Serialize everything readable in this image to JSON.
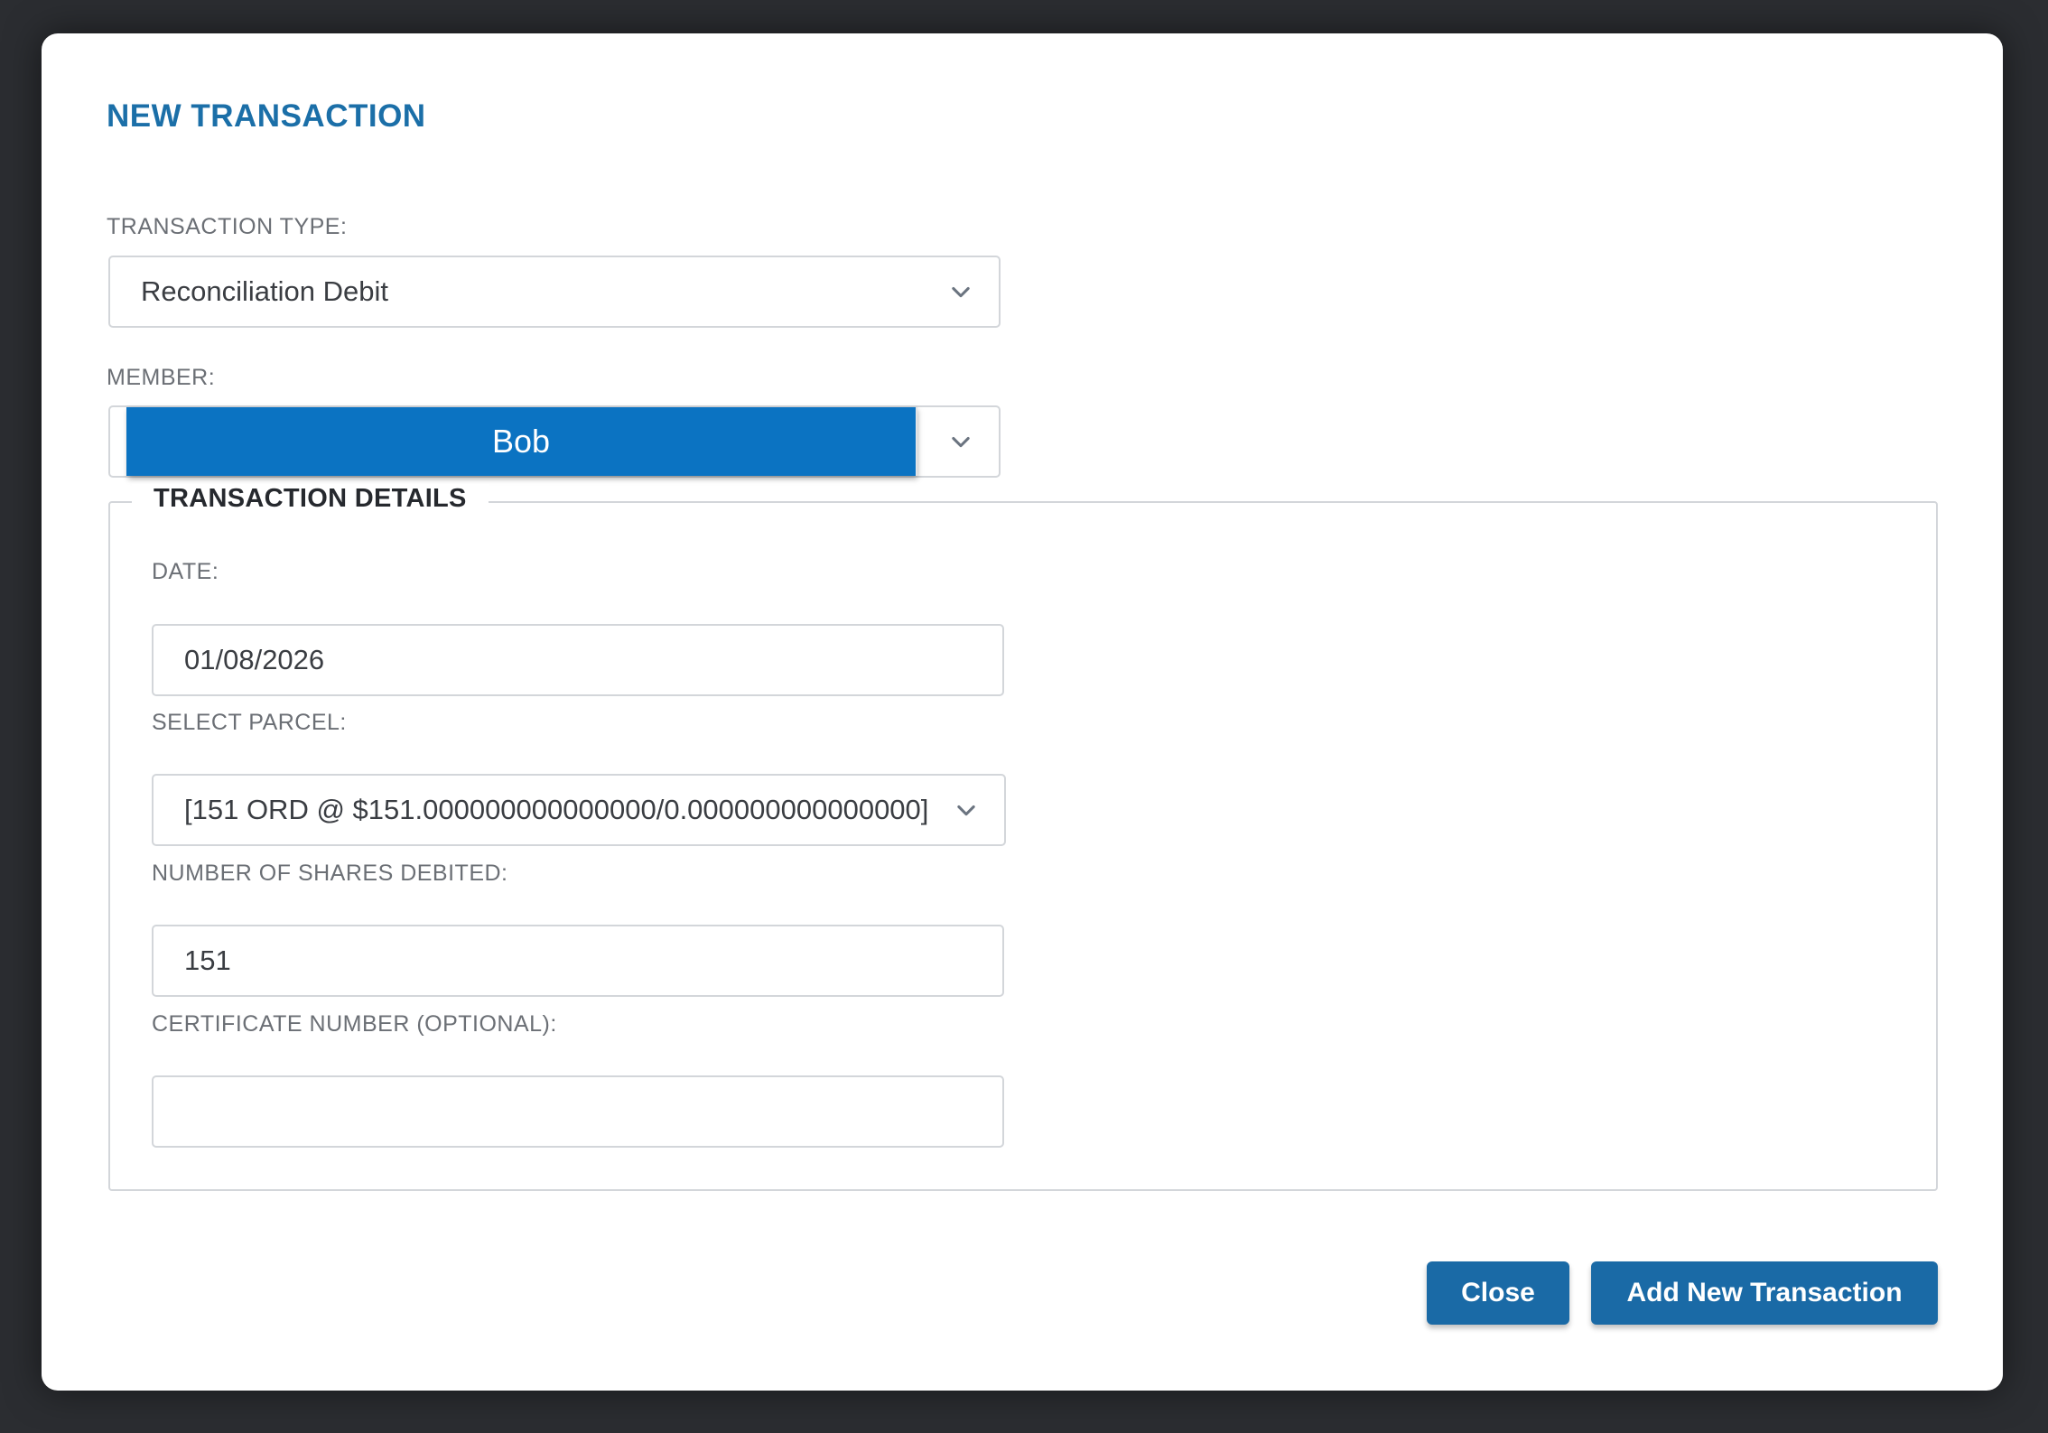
{
  "modal": {
    "title": "NEW TRANSACTION",
    "transaction_type": {
      "label": "TRANSACTION TYPE:",
      "selected": "Reconciliation Debit"
    },
    "member": {
      "label": "MEMBER:",
      "selected": "Bob"
    },
    "details": {
      "legend": "TRANSACTION DETAILS",
      "date": {
        "label": "DATE:",
        "value": "01/08/2026"
      },
      "parcel": {
        "label": "SELECT PARCEL:",
        "selected": "[151 ORD @ $151.000000000000000/0.000000000000000]"
      },
      "shares": {
        "label": "NUMBER OF SHARES DEBITED:",
        "value": "151"
      },
      "certificate": {
        "label": "CERTIFICATE NUMBER (OPTIONAL):",
        "value": ""
      }
    },
    "buttons": {
      "close": "Close",
      "add": "Add New Transaction"
    }
  },
  "colors": {
    "accent": "#1a6aa6",
    "member_highlight": "#0b73c2",
    "title": "#1b6fa8",
    "overlay": "#2b2d31"
  },
  "icons": {
    "dropdown": "chevron-down-icon"
  }
}
